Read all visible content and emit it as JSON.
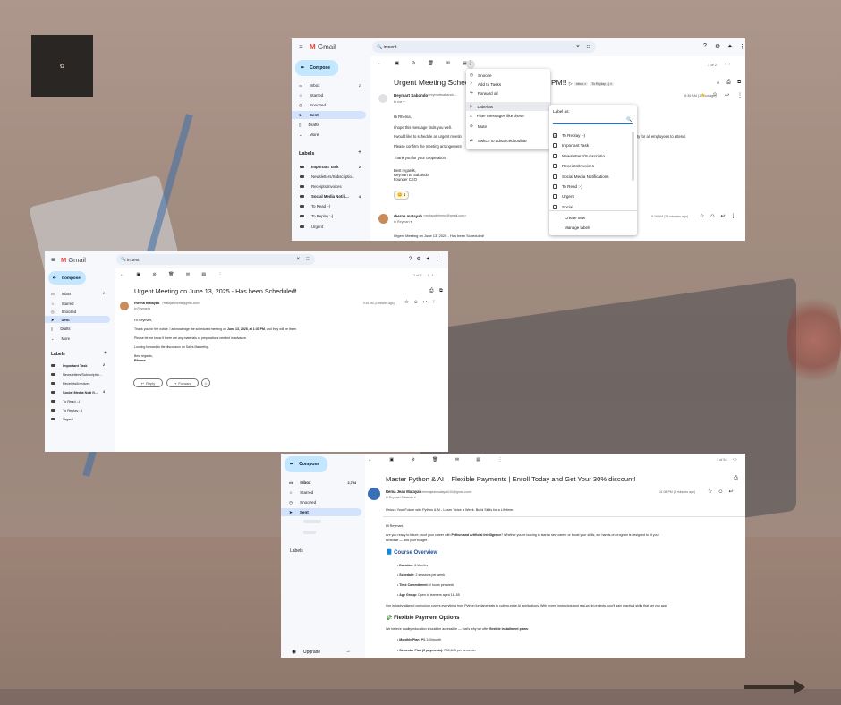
{
  "screenshot1": {
    "app_name": "Gmail",
    "compose_label": "Compose",
    "search_value": "in:sent",
    "nav": [
      {
        "label": "Inbox",
        "count": "2"
      },
      {
        "label": "Starred",
        "count": ""
      },
      {
        "label": "Snoozed",
        "count": ""
      },
      {
        "label": "Sent",
        "count": ""
      },
      {
        "label": "Drafts",
        "count": ""
      },
      {
        "label": "More",
        "count": ""
      }
    ],
    "labels_heading": "Labels",
    "labels": [
      {
        "label": "Important Task",
        "count": "2"
      },
      {
        "label": "Newsletters/Subscriptio...",
        "count": ""
      },
      {
        "label": "Receipts/Invoices",
        "count": ""
      },
      {
        "label": "Social Media Notifi...",
        "count": "4"
      },
      {
        "label": "To Read :-)",
        "count": ""
      },
      {
        "label": "To Replay :-)",
        "count": ""
      },
      {
        "label": "Urgent",
        "count": ""
      }
    ],
    "pager": "3 of 2",
    "subject": "Urgent Meeting Schedul",
    "subject_end": "PM!!",
    "chip_inbox": "Inbox ×",
    "chip_toreplay": "To Replay :-) ×",
    "sender": "Reymart Sabando",
    "sender_email": "<reymartsabando...",
    "to_me": "to me ▾",
    "time1": "8:36 AM (1 hour ago)",
    "body": [
      "Hi Rhema,",
      "I hope this message finds you well.",
      "I would like to schedule an urgent meetin",
      "Please confirm the meeting arrangement",
      "Thank you for your cooperation.",
      "Best regards,",
      "Reymart B. Sabando",
      "Founder CEO"
    ],
    "body_tail": "ty for all employees to attend.",
    "reaction": "😊 1",
    "reply_sender": "rherna matayab",
    "reply_email": "<matayabrhema@gmail.com>",
    "reply_to": "to Reymart ▾",
    "reply_time": "9:16 AM (26 minutes ago)",
    "reply_preview": "Urgent Meeting on June 13, 2025 - Has been Scheduled!",
    "more_menu": [
      "Snooze",
      "Add to Tasks",
      "Forward all",
      "Label as",
      "Filter messages like these",
      "Mute",
      "Switch to advanced toolbar"
    ],
    "label_as_title": "Label as:",
    "label_options": [
      {
        "label": "To Replay :-)",
        "checked": true
      },
      {
        "label": "Important Task",
        "checked": false
      },
      {
        "label": "Newsletters/Subscriptio...",
        "checked": false
      },
      {
        "label": "Receipts/Invoices",
        "checked": false
      },
      {
        "label": "Social Media Notifications",
        "checked": false
      },
      {
        "label": "To Read :-)",
        "checked": false
      },
      {
        "label": "Urgent",
        "checked": false
      },
      {
        "label": "Social",
        "checked": false
      }
    ],
    "create_new": "Create new",
    "manage_labels": "Manage labels"
  },
  "screenshot2": {
    "app_name": "Gmail",
    "compose_label": "Compose",
    "search_value": "in:sent",
    "nav": [
      {
        "label": "Inbox",
        "count": "2"
      },
      {
        "label": "Starred",
        "count": ""
      },
      {
        "label": "Snoozed",
        "count": ""
      },
      {
        "label": "Sent",
        "count": ""
      },
      {
        "label": "Drafts",
        "count": ""
      },
      {
        "label": "More",
        "count": ""
      }
    ],
    "labels_heading": "Labels",
    "labels": [
      {
        "label": "Important Task",
        "count": "2"
      },
      {
        "label": "Newsletters/Subscriptio...",
        "count": ""
      },
      {
        "label": "Receipts/Invoices",
        "count": ""
      },
      {
        "label": "Social Media Noti fi...",
        "count": "4"
      },
      {
        "label": "To Read :-)",
        "count": ""
      },
      {
        "label": "To Replay :-)",
        "count": ""
      },
      {
        "label": "Urgent",
        "count": ""
      }
    ],
    "pager": "1 of 2",
    "subject": "Urgent Meeting on June 13, 2025 - Has been Scheduled!",
    "sender": "rherna matayab",
    "sender_email": "<matayabrhema@gmail.com>",
    "to": "to Reymart ▾",
    "time": "9:16 AM (3 minutes ago)",
    "greeting": "Hi Reymart,",
    "line1_pre": "Thank you for the notice. I acknowledge the scheduled meeting on ",
    "line1_bold": "June 13, 2025, at 1:30 PM",
    "line1_post": ", and they will be there.",
    "line2": "Please let me know if there are any materials or preparations needed in advance.",
    "line3": "Looking forward to the discussion on Sales Marketing.",
    "regards": "Best regards,",
    "signature": "Rhema",
    "reply_btn": "Reply",
    "forward_btn": "Forward"
  },
  "screenshot3": {
    "compose_label": "Compose",
    "nav": [
      {
        "label": "Inbox",
        "count": "2,794"
      },
      {
        "label": "Starred",
        "count": ""
      },
      {
        "label": "Snoozed",
        "count": ""
      },
      {
        "label": "Sent",
        "count": ""
      }
    ],
    "labels_heading": "Labels",
    "upgrade": "Upgrade",
    "pager": "1 of 54",
    "subject": "Master Python & AI – Flexible Payments | Enroll Today and Get Your 30% discount!",
    "sender": "Rema Jean Matayab",
    "sender_email": "<rhemajeanmatayab104@gmail.com>",
    "to": "to Reymart Sabando ▾",
    "time": "11:08 PM (3 minutes ago)",
    "preheader": "Unlock Your Future with Python & AI - Learn Twice a Week. Build Skills for a Lifetime.",
    "greeting": "Hi Reymart,",
    "intro_pre": "Are you ready to future-proof your career with ",
    "intro_bold": "Python and Artificial Intelligence",
    "intro_post": "? Whether you're looking to start a new career or boost your skills, our hands-on program is designed to fit your",
    "intro_line2": "schedule — and your budget.",
    "course_heading": "📘 Course Overview",
    "course_items": [
      {
        "k": "Duration:",
        "v": " 6 Months"
      },
      {
        "k": "Schedule:",
        "v": " 2 sessions per week"
      },
      {
        "k": "Time Commitment:",
        "v": " 4 hours per week"
      },
      {
        "k": "Age Group:",
        "v": " Open to learners aged 18–55"
      }
    ],
    "curriculum": "Our industry-aligned curriculum covers everything from Python fundamentals to cutting-edge AI applications. With expert instructors and real-world projects, you'll gain practical skills that set you apa",
    "payment_heading": "💸 Flexible Payment Options",
    "payment_pre": "We believe quality education should be accessible — that's why we offer ",
    "payment_bold": "flexible installment plans",
    "payment_post": ":",
    "payment_items": [
      {
        "k": "Monthly Plan:",
        "v": " ₱5,140/month"
      },
      {
        "k": "Semester Plan (2 payments):",
        "v": " ₱30,843 per semester"
      }
    ]
  }
}
